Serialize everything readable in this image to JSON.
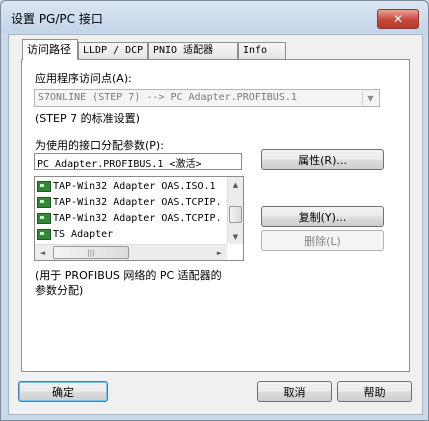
{
  "window": {
    "title": "设置 PG/PC 接口",
    "close_glyph": "✕"
  },
  "tabs": [
    {
      "label": "访问路径",
      "active": true
    },
    {
      "label": "LLDP / DCP"
    },
    {
      "label": "PNIO 适配器"
    },
    {
      "label": "Info"
    }
  ],
  "access_point": {
    "label": "应用程序访问点(A):",
    "value": "S7ONLINE  (STEP 7)       --> PC Adapter.PROFIBUS.1",
    "note": "(STEP 7 的标准设置)"
  },
  "params": {
    "label": "为使用的接口分配参数(P):",
    "value": "PC Adapter.PROFIBUS.1  <激活>",
    "properties_button": "属性(R)..."
  },
  "interfaces": [
    "TAP-Win32 Adapter OAS.ISO.1",
    "TAP-Win32 Adapter OAS.TCPIP.",
    "TAP-Win32 Adapter OAS.TCPIP.",
    "TS Adapter"
  ],
  "scrollbar": {
    "up": "▲",
    "down": "▼",
    "left": "◄",
    "right": "►",
    "grip": "|||"
  },
  "buttons": {
    "copy": "复制(Y)...",
    "delete": "删除(L)",
    "ok": "确定",
    "cancel": "取消",
    "help": "帮助"
  },
  "description": [
    "(用于 PROFIBUS 网络的 PC 适配器的",
    "参数分配)"
  ]
}
